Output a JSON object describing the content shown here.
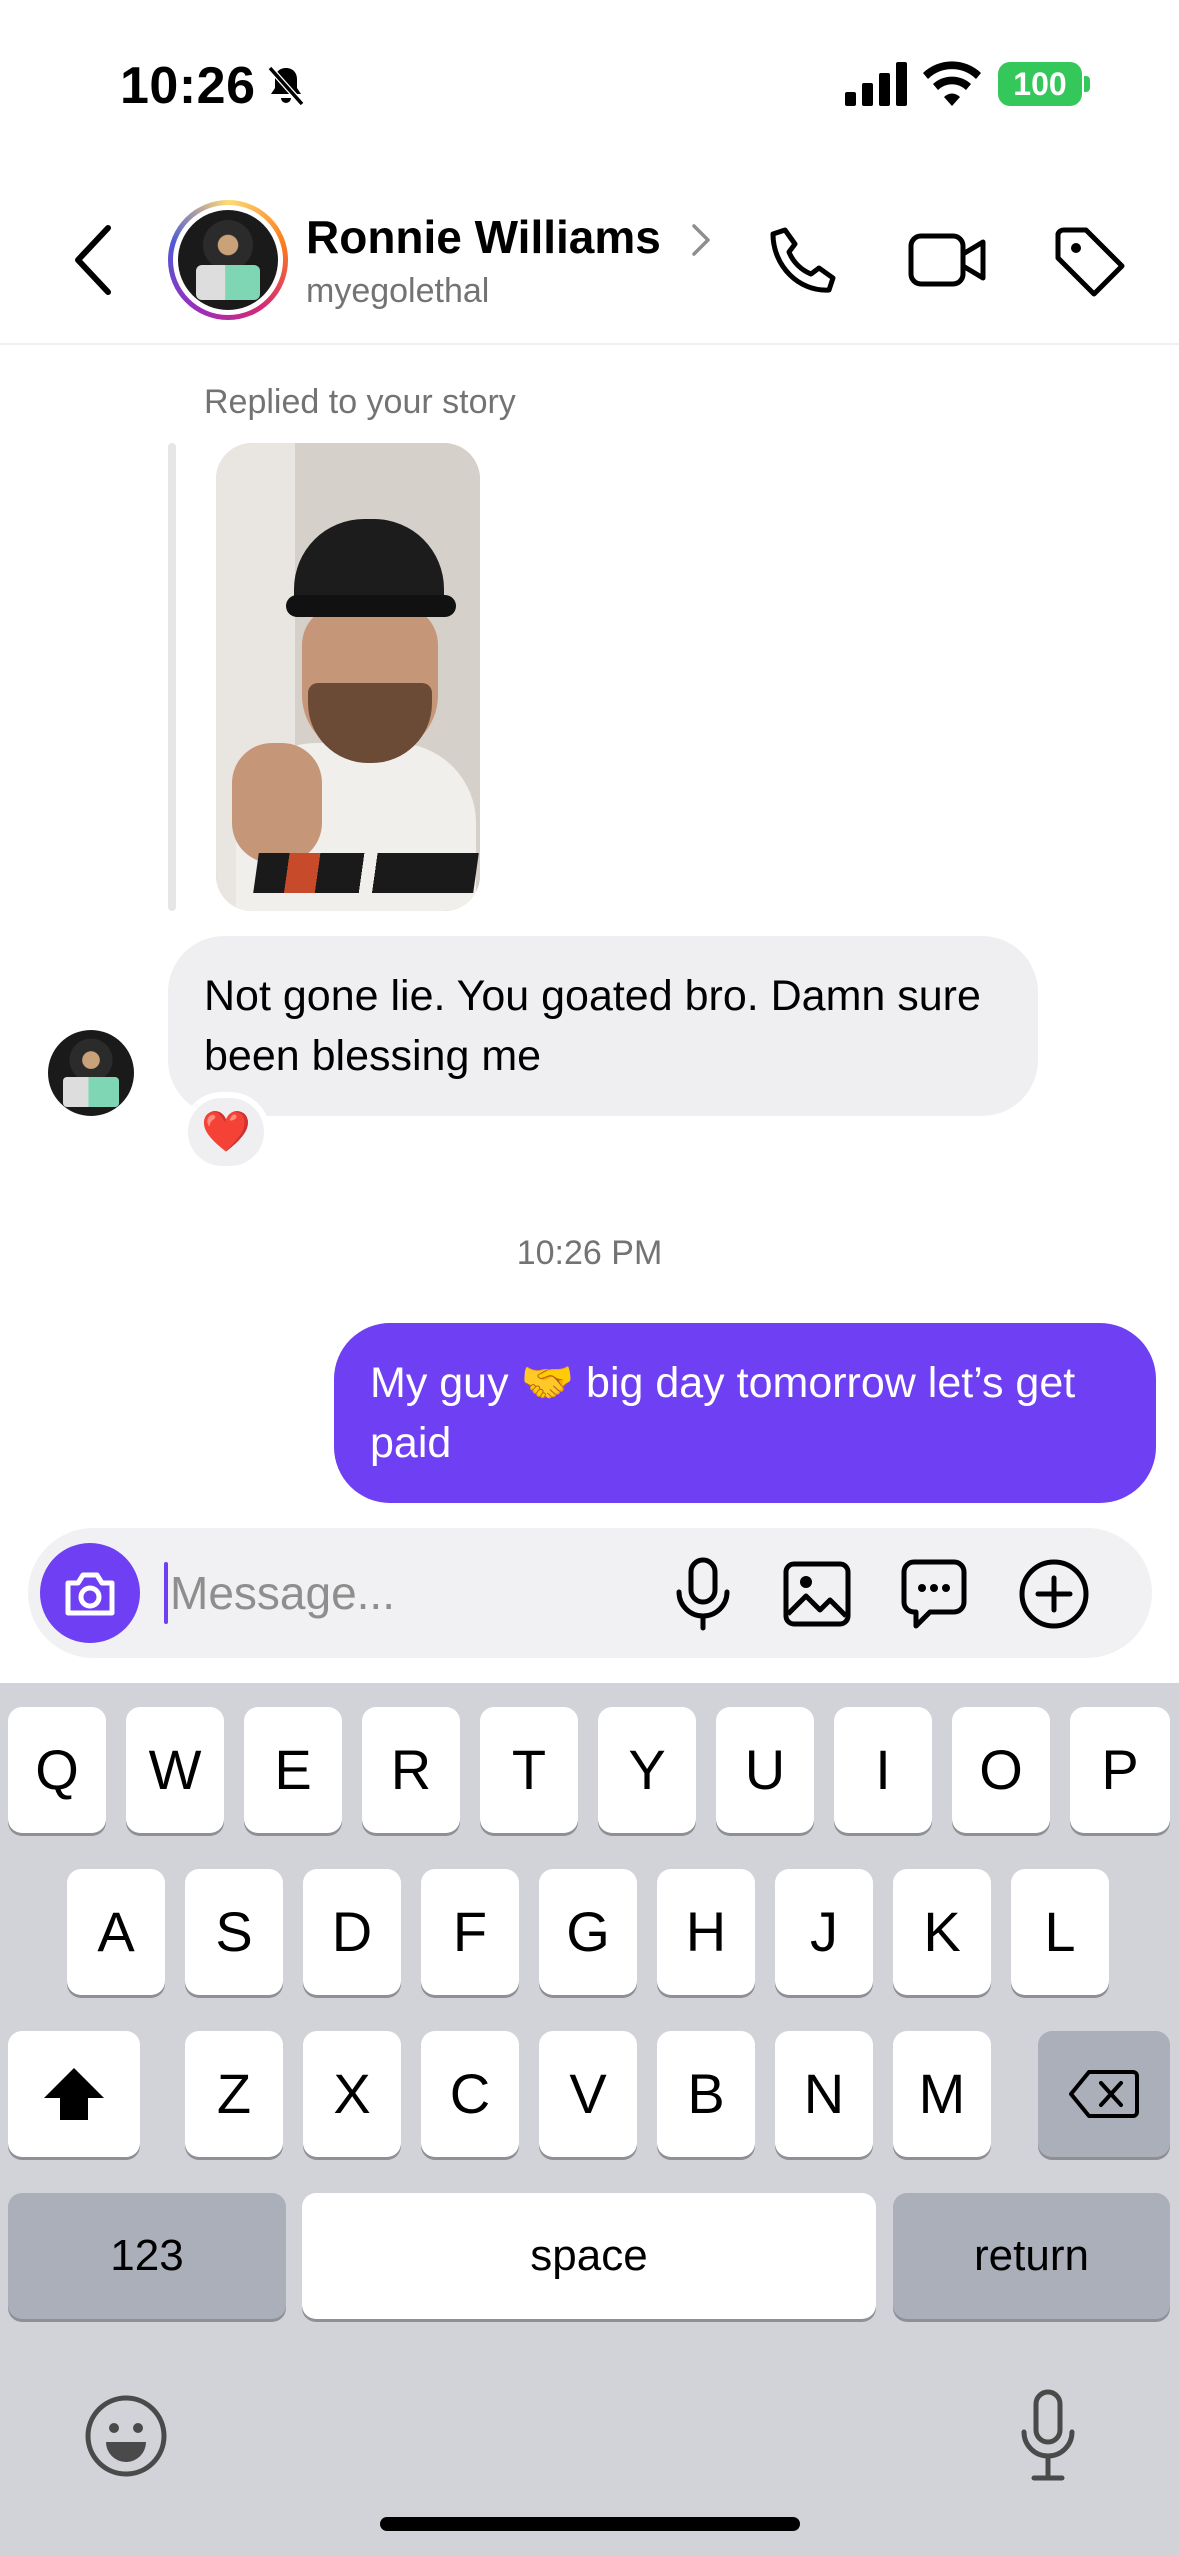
{
  "status_bar": {
    "time": "10:26",
    "battery": "100"
  },
  "header": {
    "contact_name": "Ronnie Williams",
    "contact_handle": "myegolethal"
  },
  "thread": {
    "reply_label": "Replied to your story",
    "incoming_message": "Not gone lie. You goated bro.  Damn sure been blessing me",
    "reaction": "❤️",
    "timestamp": "10:26 PM",
    "outgoing_message": "My guy 🤝 big day tomorrow let’s get paid"
  },
  "composer": {
    "placeholder": "Message..."
  },
  "keyboard": {
    "row1": [
      "Q",
      "W",
      "E",
      "R",
      "T",
      "Y",
      "U",
      "I",
      "O",
      "P"
    ],
    "row2": [
      "A",
      "S",
      "D",
      "F",
      "G",
      "H",
      "J",
      "K",
      "L"
    ],
    "row3": [
      "Z",
      "X",
      "C",
      "V",
      "B",
      "N",
      "M"
    ],
    "numbers_label": "123",
    "space_label": "space",
    "return_label": "return"
  },
  "colors": {
    "accent": "#6e3ff3",
    "battery": "#34c759",
    "keyboard_bg": "#d1d3d9"
  }
}
